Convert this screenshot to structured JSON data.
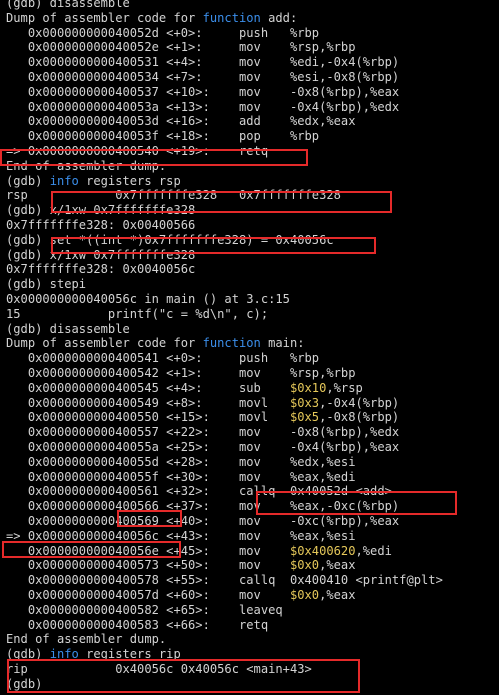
{
  "terminal": {
    "lines": [
      {
        "text": "(gdb) disassemble"
      },
      {
        "text": "Dump of assembler code for ",
        "kw": "function",
        "tail": " add:"
      },
      {
        "text": "   0x000000000040052d <+0>:     push   %rbp"
      },
      {
        "text": "   0x000000000040052e <+1>:     mov    %rsp,%rbp"
      },
      {
        "text": "   0x0000000000400531 <+4>:     mov    %edi,-0x4(%rbp)"
      },
      {
        "text": "   0x0000000000400534 <+7>:     mov    %esi,-0x8(%rbp)"
      },
      {
        "text": "   0x0000000000400537 <+10>:    mov    -0x8(%rbp),%eax"
      },
      {
        "text": "   0x000000000040053a <+13>:    mov    -0x4(%rbp),%edx"
      },
      {
        "text": "   0x000000000040053d <+16>:    add    %edx,%eax"
      },
      {
        "text": "   0x000000000040053f <+18>:    pop    %rbp"
      },
      {
        "text": "=> 0x0000000000400540 <+19>:    retq"
      },
      {
        "text": "End of assembler dump."
      },
      {
        "text": "(gdb) ",
        "kw": "info",
        "tail": " registers rsp"
      },
      {
        "text": "rsp            0x7fffffffe328   0x7fffffffe328"
      },
      {
        "text": "(gdb) x/1xw 0x7fffffffe328"
      },
      {
        "text": "0x7fffffffe328: 0x00400566"
      },
      {
        "text": "(gdb) set *((int *)0x7fffffffe328) = 0x40056c"
      },
      {
        "text": "(gdb) x/1xw 0x7fffffffe328"
      },
      {
        "text": "0x7fffffffe328: 0x0040056c"
      },
      {
        "text": "(gdb) stepi"
      },
      {
        "text": "0x000000000040056c in main () at 3.c:15"
      },
      {
        "text": "15            printf(\"c = %d\\n\", c);"
      },
      {
        "text": "(gdb) disassemble"
      },
      {
        "text": "Dump of assembler code for ",
        "kw": "function",
        "tail": " main:"
      },
      {
        "text": "   0x0000000000400541 <+0>:     push   %rbp"
      },
      {
        "text": "   0x0000000000400542 <+1>:     mov    %rsp,%rbp"
      },
      {
        "text": "   0x0000000000400545 <+4>:     sub    ",
        "lit": "$0x10",
        "tail": ",%rsp"
      },
      {
        "text": "   0x0000000000400549 <+8>:     movl   ",
        "lit": "$0x3",
        "tail": ",-0x4(%rbp)"
      },
      {
        "text": "   0x0000000000400550 <+15>:    movl   ",
        "lit": "$0x5",
        "tail": ",-0x8(%rbp)"
      },
      {
        "text": "   0x0000000000400557 <+22>:    mov    -0x8(%rbp),%edx"
      },
      {
        "text": "   0x000000000040055a <+25>:    mov    -0x4(%rbp),%eax"
      },
      {
        "text": "   0x000000000040055d <+28>:    mov    %edx,%esi"
      },
      {
        "text": "   0x000000000040055f <+30>:    mov    %eax,%edi"
      },
      {
        "text": "   0x0000000000400561 <+32>:    callq  0x40052d <add>"
      },
      {
        "text": "   0x0000000000400566 <+37>:    mov    %eax,-0xc(%rbp)"
      },
      {
        "text": "   0x0000000000400569 <+40>:    mov    -0xc(%rbp),%eax"
      },
      {
        "text": "=> 0x000000000040056c <+43>:    mov    %eax,%esi"
      },
      {
        "text": "   0x000000000040056e <+45>:    mov    ",
        "lit": "$0x400620",
        "tail": ",%edi"
      },
      {
        "text": "   0x0000000000400573 <+50>:    mov    ",
        "lit": "$0x0",
        "tail": ",%eax"
      },
      {
        "text": "   0x0000000000400578 <+55>:    callq  0x400410 <printf@plt>"
      },
      {
        "text": "   0x000000000040057d <+60>:    mov    ",
        "lit": "$0x0",
        "tail": ",%eax"
      },
      {
        "text": "   0x0000000000400582 <+65>:    leaveq"
      },
      {
        "text": "   0x0000000000400583 <+66>:    retq"
      },
      {
        "text": "End of assembler dump."
      },
      {
        "text": "(gdb) ",
        "kw": "info",
        "tail": " registers rip"
      },
      {
        "text": "rip            0x40056c 0x40056c <main+43>"
      },
      {
        "text": "(gdb) "
      }
    ]
  },
  "colors": {
    "background": "#000000",
    "text": "#d3d3d3",
    "keyword": "#3b8eea",
    "literal": "#e5c85a",
    "highlight_box": "#e52a2a"
  }
}
